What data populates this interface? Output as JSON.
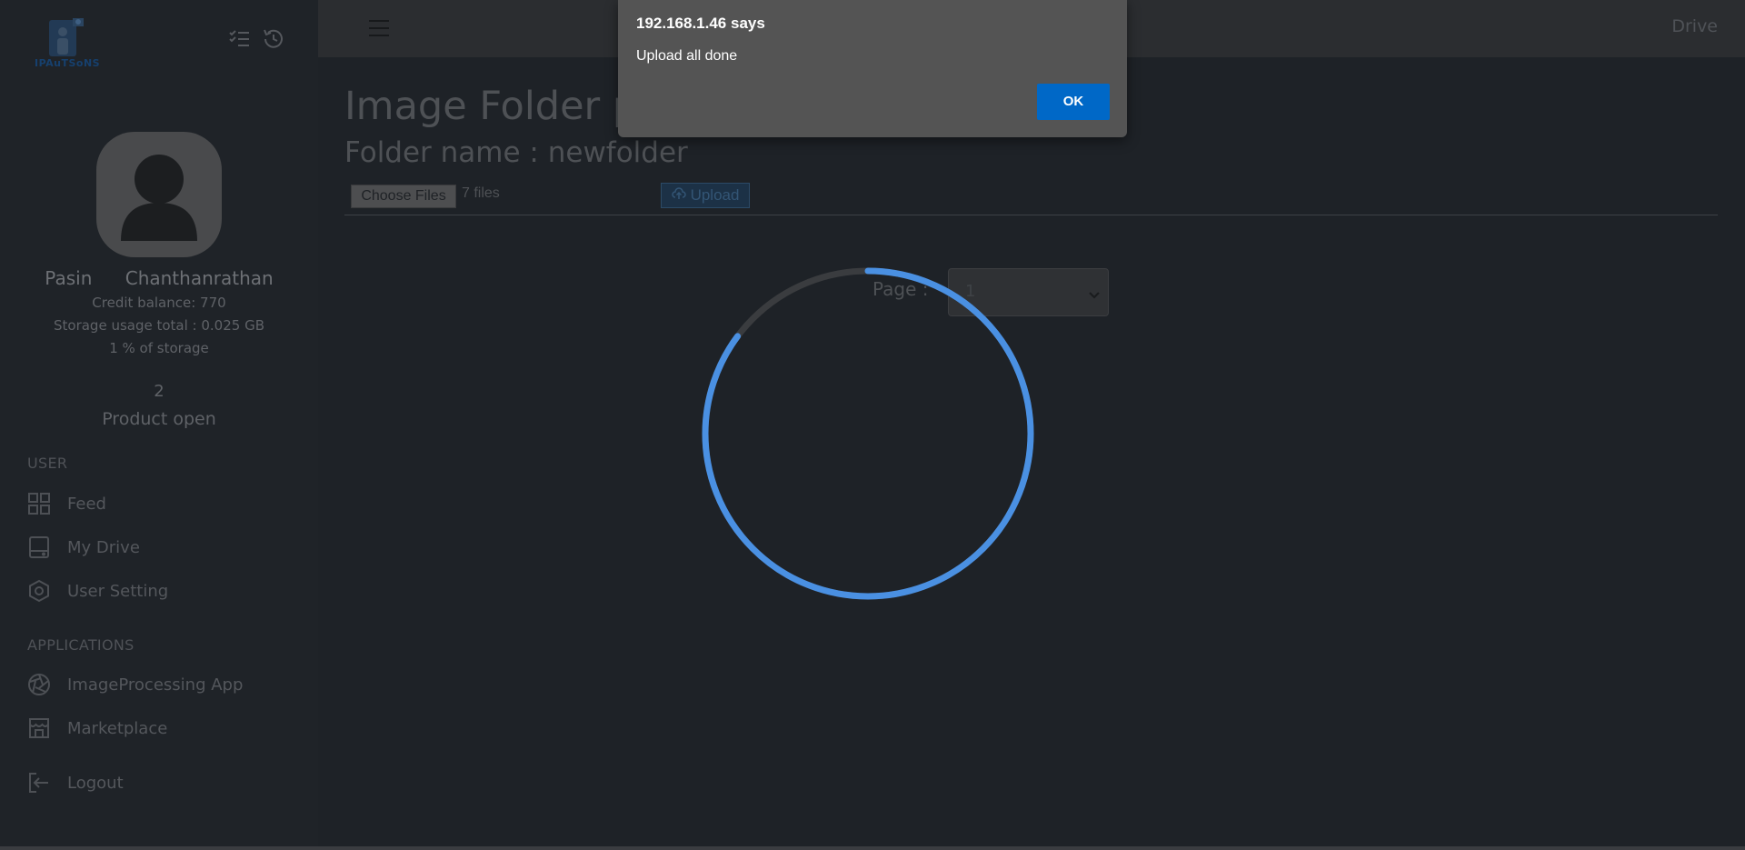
{
  "sidebar": {
    "logo_text": "IPAuTSoNS",
    "user": {
      "first_name": "Pasin",
      "last_name": "Chanthanrathan",
      "credit": "Credit balance: 770",
      "storage_total": "Storage usage total : 0.025 GB",
      "storage_percent": "1 % of storage"
    },
    "product_count": "2",
    "product_label": "Product open",
    "sections": {
      "user": "USER",
      "applications": "APPLICATIONS"
    },
    "nav": {
      "feed": "Feed",
      "my_drive": "My Drive",
      "user_setting": "User Setting",
      "image_processing": "ImageProcessing App",
      "marketplace": "Marketplace",
      "logout": "Logout"
    }
  },
  "header": {
    "drive_label": "Drive"
  },
  "main": {
    "page_title": "Image Folder pa",
    "folder_title": "Folder name : newfolder",
    "choose_files_label": "Choose Files",
    "files_count": "7 files",
    "upload_label": "Upload",
    "page_label": "Page :",
    "page_value": "1"
  },
  "dialog": {
    "title": "192.168.1.46 says",
    "message": "Upload all done",
    "ok_label": "OK"
  },
  "colors": {
    "accent": "#0068c7",
    "spinner": "#4a90e2"
  }
}
